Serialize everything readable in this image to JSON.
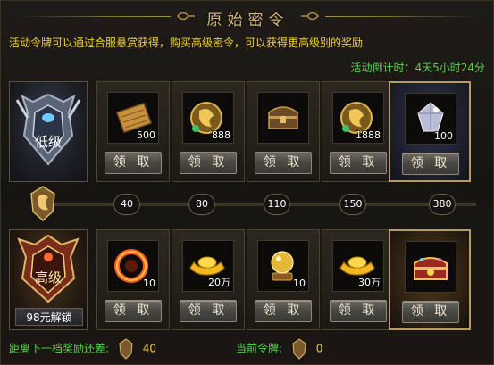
{
  "header": {
    "title": "原始密令"
  },
  "description": "活动令牌可以通过合服悬赏获得，购买高级密令，可以获得更高级别的奖励",
  "countdown": {
    "label": "活动倒计时：",
    "value": "4天5小时24分"
  },
  "claim_label": "领 取",
  "tiers": {
    "low": {
      "name": "低级",
      "icon": "low-tier-emblem"
    },
    "high": {
      "name": "高级",
      "icon": "high-tier-emblem",
      "unlock_label": "98元解锁"
    }
  },
  "progress": {
    "thresholds": [
      "40",
      "80",
      "110",
      "150",
      "380"
    ],
    "current": 0
  },
  "low_rewards": [
    {
      "icon": "scroll-icon",
      "count": "500"
    },
    {
      "icon": "dragon-token-icon",
      "count": "888"
    },
    {
      "icon": "treasure-chest-icon",
      "count": ""
    },
    {
      "icon": "dragon-token-icon",
      "count": "1888"
    },
    {
      "icon": "crystal-gem-icon",
      "count": "100"
    }
  ],
  "high_rewards": [
    {
      "icon": "fire-ring-icon",
      "count": "10"
    },
    {
      "icon": "gold-ingot-icon",
      "count": "20万"
    },
    {
      "icon": "golden-orb-icon",
      "count": "10"
    },
    {
      "icon": "gold-ingot-icon",
      "count": "30万"
    },
    {
      "icon": "jewel-chest-icon",
      "count": ""
    }
  ],
  "footer": {
    "next_label": "距离下一档奖励还差:",
    "next_value": "40",
    "current_label": "当前令牌:",
    "current_value": "0"
  },
  "colors": {
    "accent_gold": "#d8b778",
    "highlight_yellow": "#f1ce2c",
    "green_text": "#56d24c"
  }
}
